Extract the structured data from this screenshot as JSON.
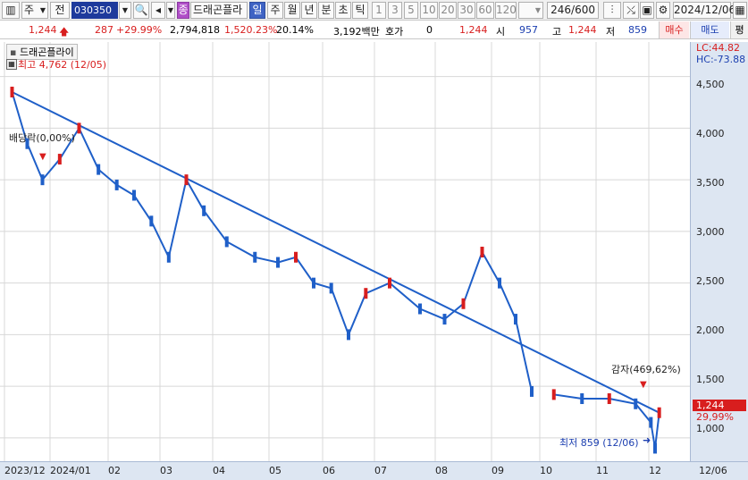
{
  "toolbar": {
    "type_select": "주",
    "period_select": "전",
    "code": "030350",
    "stock_badge": "종",
    "stock_name": "드래곤플라",
    "period_tabs": [
      "일",
      "주",
      "월",
      "년",
      "분",
      "초",
      "틱"
    ],
    "active_tab": "일",
    "intervals": [
      "1",
      "3",
      "5",
      "10",
      "20",
      "30",
      "60",
      "120"
    ],
    "count": "246",
    "count_total": "/600",
    "date": "2024/12/06"
  },
  "quote": {
    "price": "1,244",
    "change": "287",
    "change_pct": "+29.99%",
    "volume": "2,794,818",
    "volume_ratio": "1,520.23%",
    "turnover": "20.14%",
    "amount": "3,192백만",
    "hoga_label": "호가",
    "hoga_value": "0",
    "hoga_price": "1,244",
    "open_label": "시",
    "open": "957",
    "high_label": "고",
    "high": "1,244",
    "low_label": "저",
    "low": "859",
    "buy_label": "매수",
    "sell_label": "매도",
    "eval_label": "평"
  },
  "chart": {
    "legend_name": "드래곤플라이",
    "high_marker": "최고 4,762 (12/05)",
    "low_marker": "최저 859 (12/06)",
    "event_dividend": "배당락(0,00%)",
    "event_reduction": "감자(469,62%)",
    "lc": "LC:44.82",
    "hc": "HC:-73.88",
    "last_price": "1,244",
    "last_pct": "29,99%",
    "y_ticks": [
      "4,500",
      "4,000",
      "3,500",
      "3,000",
      "2,500",
      "2,000",
      "1,500",
      "1,000"
    ],
    "x_ticks": [
      "2023/12",
      "2024/01",
      "02",
      "03",
      "04",
      "05",
      "06",
      "07",
      "08",
      "09",
      "10",
      "11",
      "12"
    ],
    "x_right": "12/06",
    "colors": {
      "up": "#d81e1e",
      "down": "#1f5fc8",
      "grid": "#d8d8d8"
    }
  },
  "chart_data": {
    "type": "candlestick",
    "y_axis_range": [
      800,
      4800
    ],
    "y_ticks": [
      4500,
      4000,
      3500,
      3000,
      2500,
      2000,
      1500,
      1000
    ],
    "x_ticks": [
      "2023/12",
      "2024/01",
      "02",
      "03",
      "04",
      "05",
      "06",
      "07",
      "08",
      "09",
      "10",
      "11",
      "12"
    ],
    "series": [
      {
        "values": [
          {
            "x": "2023/12",
            "y": 4350
          },
          {
            "x": "2023/12",
            "y": 3850
          },
          {
            "x": "2023/12",
            "y": 3500
          },
          {
            "x": "2024/01",
            "y": 3700
          },
          {
            "x": "2024/01",
            "y": 4000
          },
          {
            "x": "2024/01",
            "y": 3600
          },
          {
            "x": "02",
            "y": 3450
          },
          {
            "x": "02",
            "y": 3350
          },
          {
            "x": "02",
            "y": 3100
          },
          {
            "x": "03",
            "y": 2750
          },
          {
            "x": "03",
            "y": 3500
          },
          {
            "x": "03",
            "y": 3200
          },
          {
            "x": "04",
            "y": 2900
          },
          {
            "x": "04",
            "y": 2750
          },
          {
            "x": "05",
            "y": 2700
          },
          {
            "x": "05",
            "y": 2750
          },
          {
            "x": "05",
            "y": 2500
          },
          {
            "x": "06",
            "y": 2450
          },
          {
            "x": "06",
            "y": 2000
          },
          {
            "x": "06",
            "y": 2400
          },
          {
            "x": "07",
            "y": 2500
          },
          {
            "x": "07",
            "y": 2250
          },
          {
            "x": "08",
            "y": 2150
          },
          {
            "x": "08",
            "y": 2300
          },
          {
            "x": "08",
            "y": 2800
          },
          {
            "x": "09",
            "y": 2500
          },
          {
            "x": "09",
            "y": 2150
          },
          {
            "x": "09",
            "y": 1450
          },
          {
            "x": "10",
            "y": 1420
          },
          {
            "x": "10",
            "y": 1380
          },
          {
            "x": "11",
            "y": 1380
          },
          {
            "x": "11",
            "y": 1330
          },
          {
            "x": "12",
            "y": 1150
          },
          {
            "x": "12",
            "y": 900
          },
          {
            "x": "12",
            "y": 1244
          }
        ]
      }
    ]
  }
}
